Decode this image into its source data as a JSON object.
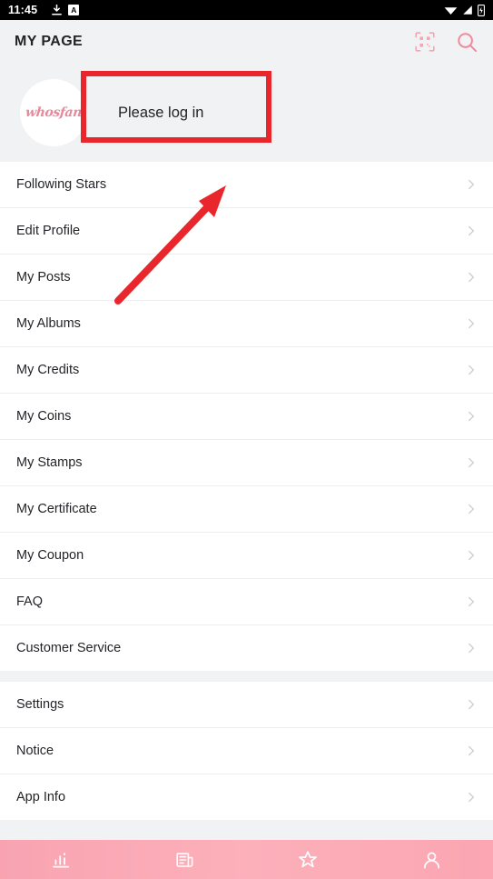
{
  "status_bar": {
    "time": "11:45",
    "left_icons": [
      "download-icon",
      "app-badge-a-icon"
    ],
    "app_badge_letter": "A",
    "right_icons": [
      "wifi-icon",
      "signal-icon",
      "battery-charging-icon"
    ],
    "background": "#000000"
  },
  "header": {
    "title": "MY PAGE",
    "actions": [
      {
        "name": "qr-scan-icon"
      },
      {
        "name": "search-icon"
      }
    ],
    "accent_color": "#f6a5b4",
    "background": "#f1f2f4"
  },
  "profile": {
    "avatar_logo_text": "whosfan",
    "avatar_logo_color": "#e8889b",
    "login_prompt": "Please log in"
  },
  "annotations": {
    "highlight_box": {
      "color": "#e8262b",
      "target": "Please log in"
    },
    "arrow": {
      "color": "#e8262b",
      "points_to": "Following Stars"
    }
  },
  "menu": {
    "groups": [
      {
        "items": [
          {
            "label": "Following Stars",
            "name": "menu-item-following-stars"
          },
          {
            "label": "Edit Profile",
            "name": "menu-item-edit-profile"
          },
          {
            "label": "My Posts",
            "name": "menu-item-my-posts"
          },
          {
            "label": "My Albums",
            "name": "menu-item-my-albums"
          },
          {
            "label": "My Credits",
            "name": "menu-item-my-credits"
          },
          {
            "label": "My Coins",
            "name": "menu-item-my-coins"
          },
          {
            "label": "My Stamps",
            "name": "menu-item-my-stamps"
          },
          {
            "label": "My Certificate",
            "name": "menu-item-my-certificate"
          },
          {
            "label": "My Coupon",
            "name": "menu-item-my-coupon"
          },
          {
            "label": "FAQ",
            "name": "menu-item-faq"
          },
          {
            "label": "Customer Service",
            "name": "menu-item-customer-service"
          }
        ]
      },
      {
        "items": [
          {
            "label": "Settings",
            "name": "menu-item-settings"
          },
          {
            "label": "Notice",
            "name": "menu-item-notice"
          },
          {
            "label": "App Info",
            "name": "menu-item-app-info"
          }
        ]
      }
    ],
    "chevron_icon": "chevron-right-icon"
  },
  "bottom_nav": {
    "background_start": "#f9a3b1",
    "background_end": "#fba6b2",
    "items": [
      {
        "name": "nav-chart-icon",
        "label": "Chart"
      },
      {
        "name": "nav-news-icon",
        "label": "News"
      },
      {
        "name": "nav-star-icon",
        "label": "Star"
      },
      {
        "name": "nav-profile-icon",
        "label": "My Page"
      }
    ]
  }
}
